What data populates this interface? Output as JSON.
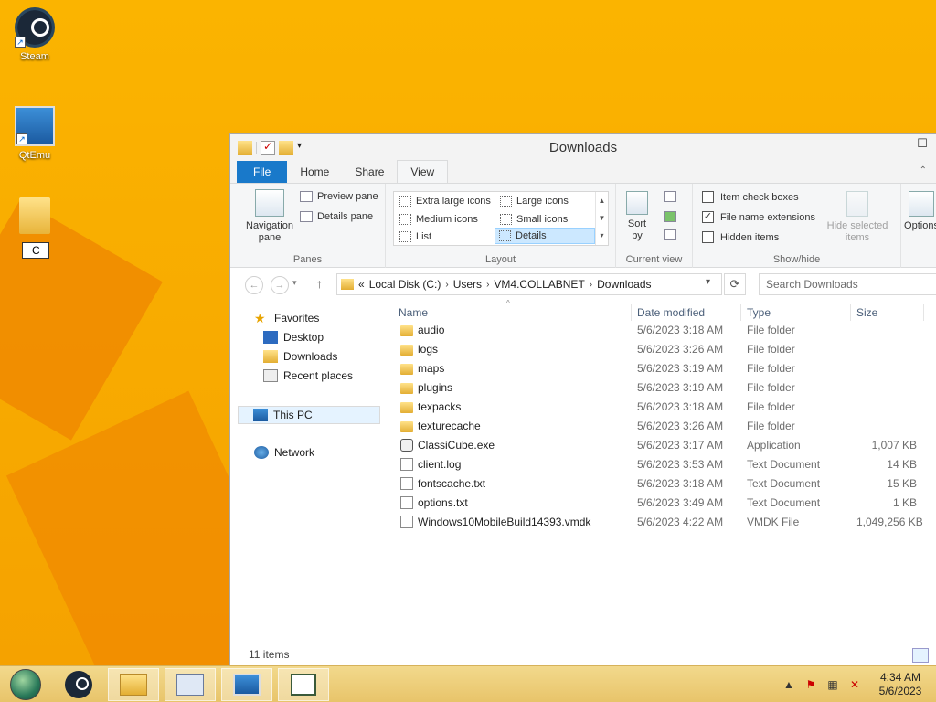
{
  "desktop": {
    "icons": [
      {
        "label": "Steam",
        "icon": "steam-icon"
      },
      {
        "label": "QtEmu",
        "icon": "qtemu-icon"
      }
    ],
    "rename_value": "C"
  },
  "window": {
    "title": "Downloads",
    "controls": {
      "minimize": "—",
      "maximize": "☐"
    },
    "tabs": [
      "File",
      "Home",
      "Share",
      "View"
    ],
    "ribbon": {
      "panes": {
        "navigation_pane": "Navigation pane",
        "preview_pane": "Preview pane",
        "details_pane": "Details pane",
        "label": "Panes"
      },
      "layout": {
        "items": [
          "Extra large icons",
          "Large icons",
          "Medium icons",
          "Small icons",
          "List",
          "Details"
        ],
        "selected": "Details",
        "label": "Layout"
      },
      "current_view": {
        "sort_by": "Sort by",
        "label": "Current view"
      },
      "show_hide": {
        "item_check_boxes": "Item check boxes",
        "file_name_extensions": "File name extensions",
        "hidden_items": "Hidden items",
        "hide_selected_items": "Hide selected items",
        "label": "Show/hide",
        "checked": {
          "item_check_boxes": false,
          "file_name_extensions": true,
          "hidden_items": false
        }
      },
      "options": "Options"
    },
    "address": {
      "prefix": "«",
      "crumbs": [
        "Local Disk (C:)",
        "Users",
        "VM4.COLLABNET",
        "Downloads"
      ],
      "search_placeholder": "Search Downloads"
    },
    "nav": {
      "favorites": "Favorites",
      "desktop": "Desktop",
      "downloads": "Downloads",
      "recent": "Recent places",
      "this_pc": "This PC",
      "network": "Network"
    },
    "columns": {
      "name": "Name",
      "date": "Date modified",
      "type": "Type",
      "size": "Size"
    },
    "files": [
      {
        "name": "audio",
        "date": "5/6/2023 3:18 AM",
        "type": "File folder",
        "size": "",
        "kind": "folder"
      },
      {
        "name": "logs",
        "date": "5/6/2023 3:26 AM",
        "type": "File folder",
        "size": "",
        "kind": "folder"
      },
      {
        "name": "maps",
        "date": "5/6/2023 3:19 AM",
        "type": "File folder",
        "size": "",
        "kind": "folder"
      },
      {
        "name": "plugins",
        "date": "5/6/2023 3:19 AM",
        "type": "File folder",
        "size": "",
        "kind": "folder"
      },
      {
        "name": "texpacks",
        "date": "5/6/2023 3:18 AM",
        "type": "File folder",
        "size": "",
        "kind": "folder"
      },
      {
        "name": "texturecache",
        "date": "5/6/2023 3:26 AM",
        "type": "File folder",
        "size": "",
        "kind": "folder"
      },
      {
        "name": "ClassiCube.exe",
        "date": "5/6/2023 3:17 AM",
        "type": "Application",
        "size": "1,007 KB",
        "kind": "exe"
      },
      {
        "name": "client.log",
        "date": "5/6/2023 3:53 AM",
        "type": "Text Document",
        "size": "14 KB",
        "kind": "doc"
      },
      {
        "name": "fontscache.txt",
        "date": "5/6/2023 3:18 AM",
        "type": "Text Document",
        "size": "15 KB",
        "kind": "doc"
      },
      {
        "name": "options.txt",
        "date": "5/6/2023 3:49 AM",
        "type": "Text Document",
        "size": "1 KB",
        "kind": "doc"
      },
      {
        "name": "Windows10MobileBuild14393.vmdk",
        "date": "5/6/2023 4:22 AM",
        "type": "VMDK File",
        "size": "1,049,256 KB",
        "kind": "doc"
      }
    ],
    "status": "11 items"
  },
  "taskbar": {
    "clock_time": "4:34 AM",
    "clock_date": "5/6/2023",
    "tray_icons": [
      "show-hidden-icons",
      "action-center-icon",
      "network-icon",
      "volume-muted-icon"
    ]
  }
}
